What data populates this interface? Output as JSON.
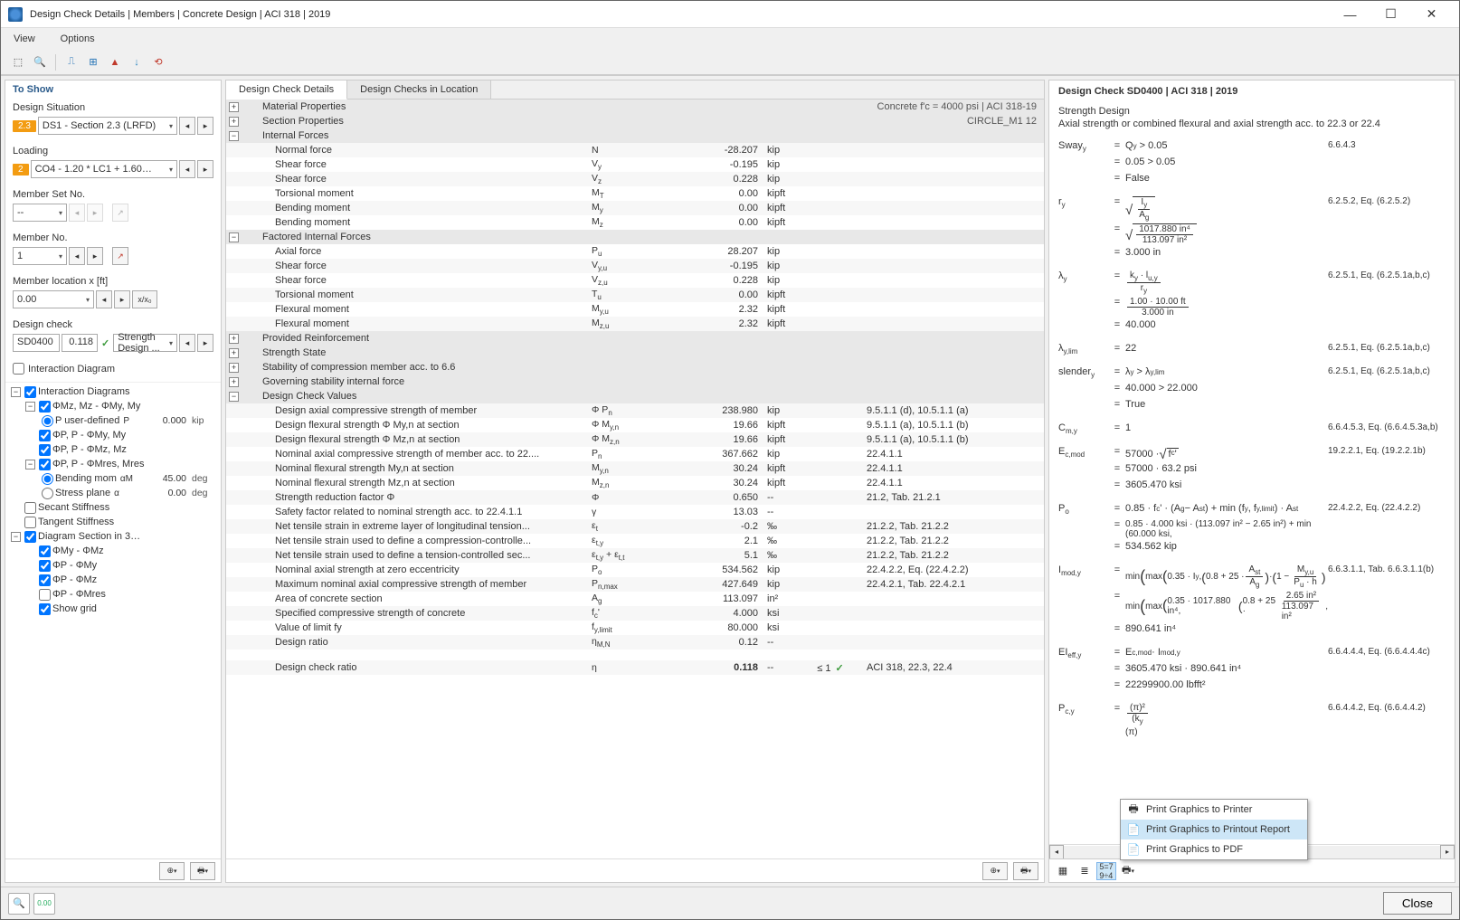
{
  "titlebar": {
    "title": "Design Check Details | Members | Concrete Design | ACI 318 | 2019"
  },
  "menu": {
    "view": "View",
    "options": "Options"
  },
  "left": {
    "header": "To Show",
    "design_situation_label": "Design Situation",
    "design_situation_badge": "2.3",
    "design_situation": "DS1 - Section 2.3 (LRFD)",
    "loading_label": "Loading",
    "loading_badge": "2",
    "loading": "CO4 - 1.20 * LC1 + 1.60 * LC2 + ...",
    "member_set_label": "Member Set No.",
    "member_set": "--",
    "member_no_label": "Member No.",
    "member_no": "1",
    "location_label": "Member location x [ft]",
    "location": "0.00",
    "location_btn": "x/x₀",
    "design_check_label": "Design check",
    "dc_code": "SD0400",
    "dc_ratio": "0.118",
    "dc_desc": "Strength Design ...",
    "interaction_label": "Interaction Diagram",
    "tree": [
      {
        "ind": 0,
        "tgl": "−",
        "chk": true,
        "txt": "Interaction Diagrams"
      },
      {
        "ind": 1,
        "tgl": "−",
        "chk": true,
        "txt": "ΦMz, Mz - ΦMy, My"
      },
      {
        "ind": 2,
        "radio": true,
        "sel": true,
        "txt": "P user-defined",
        "sym": "P",
        "val": "0.000",
        "unit": "kip"
      },
      {
        "ind": 1,
        "tgl": "",
        "chk": true,
        "txt": "ΦP, P - ΦMy, My"
      },
      {
        "ind": 1,
        "tgl": "",
        "chk": true,
        "txt": "ΦP, P - ΦMz, Mz"
      },
      {
        "ind": 1,
        "tgl": "−",
        "chk": true,
        "txt": "ΦP, P - ΦMres, Mres"
      },
      {
        "ind": 2,
        "radio": true,
        "sel": true,
        "txt": "Bending mom",
        "sym": "αM",
        "val": "45.00",
        "unit": "deg"
      },
      {
        "ind": 2,
        "radio": true,
        "sel": false,
        "txt": "Stress plane",
        "sym": "α",
        "val": "0.00",
        "unit": "deg"
      },
      {
        "ind": 0,
        "tgl": "",
        "chk": false,
        "txt": "Secant Stiffness"
      },
      {
        "ind": 0,
        "tgl": "",
        "chk": false,
        "txt": "Tangent Stiffness"
      },
      {
        "ind": 0,
        "tgl": "−",
        "chk": true,
        "txt": "Diagram Section in 3…"
      },
      {
        "ind": 1,
        "tgl": "",
        "chk": true,
        "txt": "ΦMy - ΦMz"
      },
      {
        "ind": 1,
        "tgl": "",
        "chk": true,
        "txt": "ΦP - ΦMy"
      },
      {
        "ind": 1,
        "tgl": "",
        "chk": true,
        "txt": "ΦP - ΦMz"
      },
      {
        "ind": 1,
        "tgl": "",
        "chk": false,
        "txt": "ΦP - ΦMres"
      },
      {
        "ind": 1,
        "tgl": "",
        "chk": true,
        "txt": "Show grid"
      }
    ]
  },
  "center": {
    "tab1": "Design Check Details",
    "tab2": "Design Checks in Location",
    "sections": [
      {
        "title": "Material Properties",
        "right": "Concrete f'c = 4000 psi | ACI 318-19"
      },
      {
        "title": "Section Properties",
        "right": "CIRCLE_M1 12"
      },
      {
        "title": "Internal Forces",
        "rows": [
          {
            "l": "Normal force",
            "s": "N",
            "v": "-28.207",
            "u": "kip"
          },
          {
            "l": "Shear force",
            "s": "Vy",
            "v": "-0.195",
            "u": "kip"
          },
          {
            "l": "Shear force",
            "s": "Vz",
            "v": "0.228",
            "u": "kip"
          },
          {
            "l": "Torsional moment",
            "s": "MT",
            "v": "0.00",
            "u": "kipft"
          },
          {
            "l": "Bending moment",
            "s": "My",
            "v": "0.00",
            "u": "kipft"
          },
          {
            "l": "Bending moment",
            "s": "Mz",
            "v": "0.00",
            "u": "kipft"
          }
        ]
      },
      {
        "title": "Factored Internal Forces",
        "rows": [
          {
            "l": "Axial force",
            "s": "Pu",
            "v": "28.207",
            "u": "kip"
          },
          {
            "l": "Shear force",
            "s": "Vy,u",
            "v": "-0.195",
            "u": "kip"
          },
          {
            "l": "Shear force",
            "s": "Vz,u",
            "v": "0.228",
            "u": "kip"
          },
          {
            "l": "Torsional moment",
            "s": "Tu",
            "v": "0.00",
            "u": "kipft"
          },
          {
            "l": "Flexural moment",
            "s": "My,u",
            "v": "2.32",
            "u": "kipft"
          },
          {
            "l": "Flexural moment",
            "s": "Mz,u",
            "v": "2.32",
            "u": "kipft"
          }
        ]
      },
      {
        "title": "Provided Reinforcement"
      },
      {
        "title": "Strength State"
      },
      {
        "title": "Stability of compression member acc. to 6.6"
      },
      {
        "title": "Governing stability internal force"
      },
      {
        "title": "Design Check Values",
        "rows": [
          {
            "l": "Design axial compressive strength of member",
            "s": "Φ Pn",
            "v": "238.980",
            "u": "kip",
            "r": "9.5.1.1 (d), 10.5.1.1 (a)"
          },
          {
            "l": "Design flexural strength Φ My,n at section",
            "s": "Φ My,n",
            "v": "19.66",
            "u": "kipft",
            "r": "9.5.1.1 (a), 10.5.1.1 (b)"
          },
          {
            "l": "Design flexural strength Φ Mz,n at section",
            "s": "Φ Mz,n",
            "v": "19.66",
            "u": "kipft",
            "r": "9.5.1.1 (a), 10.5.1.1 (b)"
          },
          {
            "l": "Nominal axial compressive strength of member acc. to 22....",
            "s": "Pn",
            "v": "367.662",
            "u": "kip",
            "r": "22.4.1.1"
          },
          {
            "l": "Nominal flexural strength My,n at section",
            "s": "My,n",
            "v": "30.24",
            "u": "kipft",
            "r": "22.4.1.1"
          },
          {
            "l": "Nominal flexural strength Mz,n at section",
            "s": "Mz,n",
            "v": "30.24",
            "u": "kipft",
            "r": "22.4.1.1"
          },
          {
            "l": "Strength reduction factor Φ",
            "s": "Φ",
            "v": "0.650",
            "u": "--",
            "r": "21.2, Tab. 21.2.1"
          },
          {
            "l": "Safety factor related to nominal strength acc. to 22.4.1.1",
            "s": "γ",
            "v": "13.03",
            "u": "--",
            "r": ""
          },
          {
            "l": "Net tensile strain in extreme layer of longitudinal tension...",
            "s": "εt",
            "v": "-0.2",
            "u": "‰",
            "r": "21.2.2, Tab. 21.2.2"
          },
          {
            "l": "Net tensile strain used to define a compression-controlle...",
            "s": "εt,y",
            "v": "2.1",
            "u": "‰",
            "r": "21.2.2, Tab. 21.2.2"
          },
          {
            "l": "Net tensile strain used to define a tension-controlled sec...",
            "s": "εt,y + εt,t",
            "v": "5.1",
            "u": "‰",
            "r": "21.2.2, Tab. 21.2.2"
          },
          {
            "l": "Nominal axial strength at zero eccentricity",
            "s": "Po",
            "v": "534.562",
            "u": "kip",
            "r": "22.4.2.2, Eq. (22.4.2.2)"
          },
          {
            "l": "Maximum nominal axial compressive strength of member",
            "s": "Pn,max",
            "v": "427.649",
            "u": "kip",
            "r": "22.4.2.1, Tab. 22.4.2.1"
          },
          {
            "l": "Area of concrete section",
            "s": "Ag",
            "v": "113.097",
            "u": "in²",
            "r": ""
          },
          {
            "l": "Specified compressive strength of concrete",
            "s": "fc'",
            "v": "4.000",
            "u": "ksi",
            "r": ""
          },
          {
            "l": "Value of limit fy",
            "s": "fy,limit",
            "v": "80.000",
            "u": "ksi",
            "r": ""
          },
          {
            "l": "Design ratio",
            "s": "ηM,N",
            "v": "0.12",
            "u": "--",
            "r": ""
          }
        ]
      },
      {
        "title": "",
        "spacer": true
      },
      {
        "final": true,
        "l": "Design check ratio",
        "s": "η",
        "v": "0.118",
        "u": "--",
        "lim": "≤ 1",
        "r": "ACI 318, 22.3, 22.4"
      }
    ]
  },
  "right": {
    "title": "Design Check SD0400 | ACI 318 | 2019",
    "subtitle": "Strength Design",
    "desc": "Axial strength or combined flexural and axial strength acc. to 22.3 or 22.4",
    "menu": {
      "i1": "Print Graphics to Printer",
      "i2": "Print Graphics to Printout Report",
      "i3": "Print Graphics to PDF"
    }
  },
  "bottom": {
    "close": "Close"
  }
}
